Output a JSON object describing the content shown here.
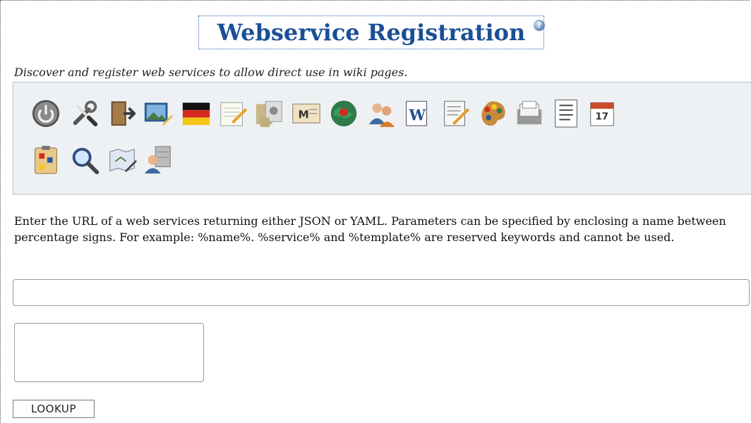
{
  "page": {
    "title": "Webservice Registration",
    "help_icon": "help-icon",
    "subtitle": "Discover and register web services to allow direct use in wiki pages."
  },
  "toolbar": {
    "icons": [
      "power-icon",
      "tools-icon",
      "exit-door-icon",
      "picture-edit-icon",
      "german-flag-icon",
      "notepad-pencil-icon",
      "file-manager-icon",
      "mail-icon",
      "globe-icon",
      "users-icon",
      "wiki-page-icon",
      "document-edit-icon",
      "palette-icon",
      "card-file-icon",
      "list-document-icon",
      "calendar-icon",
      "clipboard-diagram-icon",
      "magnifier-icon",
      "map-edit-icon",
      "user-server-icon"
    ]
  },
  "description": "Enter the URL of a web services returning either JSON or YAML. Parameters can be specified by enclosing a name between percentage signs. For example: %name%. %service% and %template% are reserved keywords and cannot be used.",
  "form": {
    "url_value": "",
    "lookup_label": "LOOKUP"
  }
}
